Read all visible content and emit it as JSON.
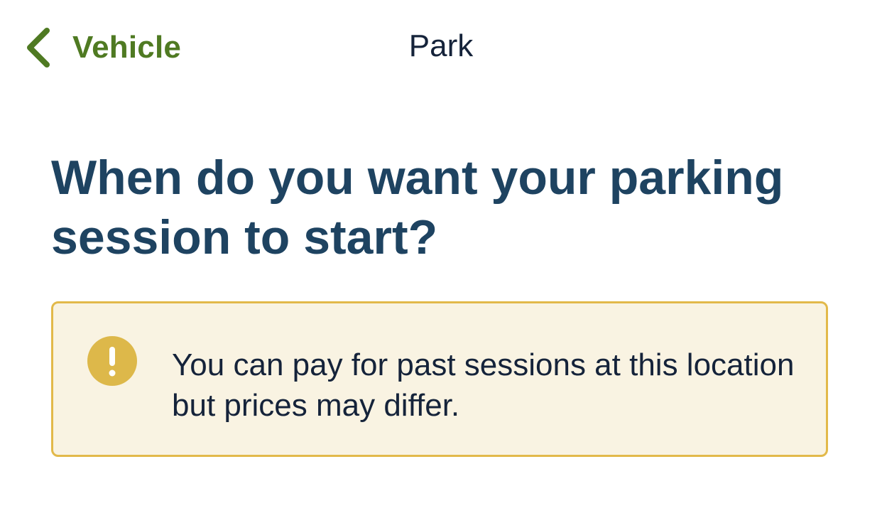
{
  "nav": {
    "back_label": "Vehicle",
    "title": "Park"
  },
  "main": {
    "heading": "When do you want your parking session to start?"
  },
  "notice": {
    "message": "You can pay for past sessions at this location but prices may differ.",
    "icon": "warning-exclamation-icon"
  },
  "colors": {
    "accent_green": "#4f7a22",
    "heading_navy": "#1e4361",
    "text_dark": "#15233a",
    "notice_background": "#f9f3e2",
    "notice_border": "#e2b94a",
    "notice_icon": "#ddb84a"
  }
}
